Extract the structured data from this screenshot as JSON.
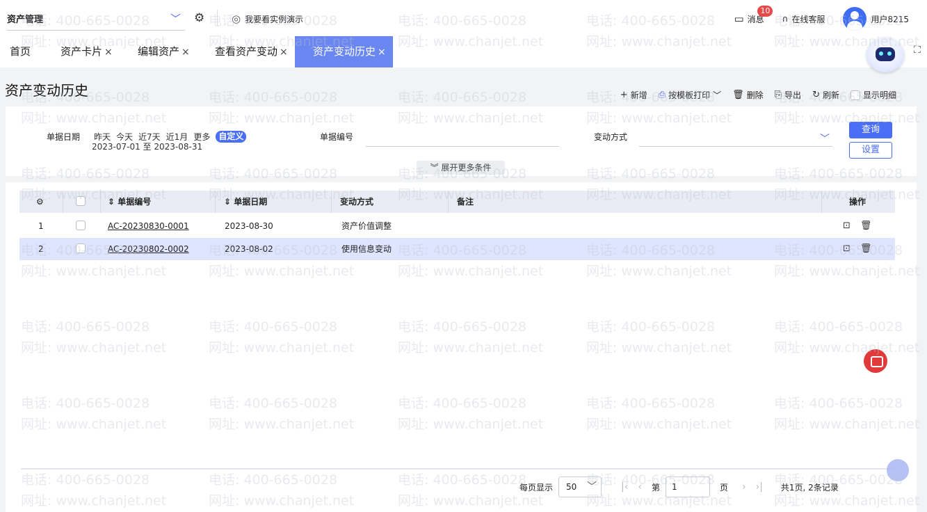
{
  "topbar": {
    "module": "资产管理",
    "demo_link": "我要看实例演示",
    "messages_label": "消息",
    "messages_count": "10",
    "service_label": "在线客服",
    "user_name": "用户8215"
  },
  "tabs": [
    {
      "label": "首页",
      "closable": false
    },
    {
      "label": "资产卡片",
      "closable": true
    },
    {
      "label": "编辑资产",
      "closable": true
    },
    {
      "label": "查看资产变动",
      "closable": true
    },
    {
      "label": "资产变动历史",
      "closable": true,
      "active": true
    }
  ],
  "tab_close": "×",
  "page": {
    "title": "资产变动历史"
  },
  "toolbar": {
    "add": "新增",
    "print": "按模板打印",
    "delete": "删除",
    "export": "导出",
    "refresh": "刷新",
    "show_detail": "显示明细"
  },
  "filter": {
    "date_label": "单据日期",
    "quick": [
      "昨天",
      "今天",
      "近7天",
      "近1月",
      "更多",
      "自定义"
    ],
    "date_range": "2023-07-01 至 2023-08-31",
    "docno_label": "单据编号",
    "docno_value": "",
    "method_label": "变动方式",
    "method_value": "",
    "query_button": "查询",
    "settings_button": "设置",
    "expand_label": "展开更多条件"
  },
  "table": {
    "columns": {
      "docno": "单据编号",
      "date": "单据日期",
      "method": "变动方式",
      "remark": "备注",
      "ops": "操作"
    },
    "rows": [
      {
        "index": "1",
        "docno": "AC-20230830-0001",
        "date": "2023-08-30",
        "method": "资产价值调整",
        "remark": "",
        "selected": false
      },
      {
        "index": "2",
        "docno": "AC-20230802-0002",
        "date": "2023-08-02",
        "method": "使用信息变动",
        "remark": "",
        "selected": true
      }
    ]
  },
  "pager": {
    "per_page_label": "每页显示",
    "per_page": "50",
    "page_prefix": "第",
    "page": "1",
    "page_suffix": "页",
    "summary": "共1页, 2条记录"
  },
  "watermark": {
    "phone": "电话: 400-665-0028",
    "site": "网址: www.chanjet.net"
  },
  "colors": {
    "accent": "#4a6ef5",
    "active_tab": "#6a86f0",
    "selected_row": "#dfe4ff",
    "badge": "#e84848"
  },
  "icons": [
    "chevron-down-icon",
    "gear-icon",
    "eye-icon",
    "message-icon",
    "headset-icon",
    "avatar",
    "close-icon",
    "robot-icon",
    "fullscreen-icon",
    "plus-icon",
    "printer-icon",
    "trash-icon",
    "export-icon",
    "refresh-icon",
    "double-chevron-down-icon",
    "sort-icon",
    "view-icon",
    "first-page-icon",
    "prev-page-icon",
    "next-page-icon",
    "last-page-icon"
  ]
}
